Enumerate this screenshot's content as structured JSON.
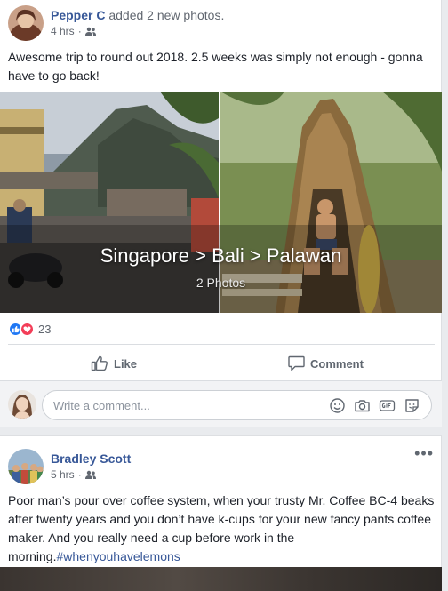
{
  "post1": {
    "author": "Pepper C",
    "action": "added 2 new photos.",
    "time": "4 hrs",
    "separator": "·",
    "audience_icon": "friends-icon",
    "text": "Awesome trip to round out 2018. 2.5 weeks was simply not enough - gonna have to go back!",
    "album": {
      "title": "Singapore > Bali > Palawan",
      "count": "2 Photos"
    },
    "reactions": {
      "icons": [
        "like-reaction-icon",
        "love-reaction-icon"
      ],
      "count": "23"
    },
    "actions": {
      "like": "Like",
      "comment": "Comment"
    },
    "comment_box": {
      "placeholder": "Write a comment...",
      "icons": [
        "emoji-icon",
        "camera-icon",
        "gif-icon",
        "sticker-icon"
      ]
    }
  },
  "post2": {
    "author": "Bradley Scott",
    "time": "5 hrs",
    "separator": "·",
    "audience_icon": "friends-icon",
    "more": "•••",
    "text": "Poor man’s pour over coffee system, when your trusty Mr. Coffee BC-4 beaks after twenty years and you don’t have k-cups for your new fancy pants coffee maker. And you really need a cup before work in the morning.",
    "hashtag": "#whenyouhavelemons"
  },
  "colors": {
    "link": "#385898",
    "like_blue": "#2078f4",
    "love_red": "#f33e58",
    "meta_gray": "#616770"
  }
}
